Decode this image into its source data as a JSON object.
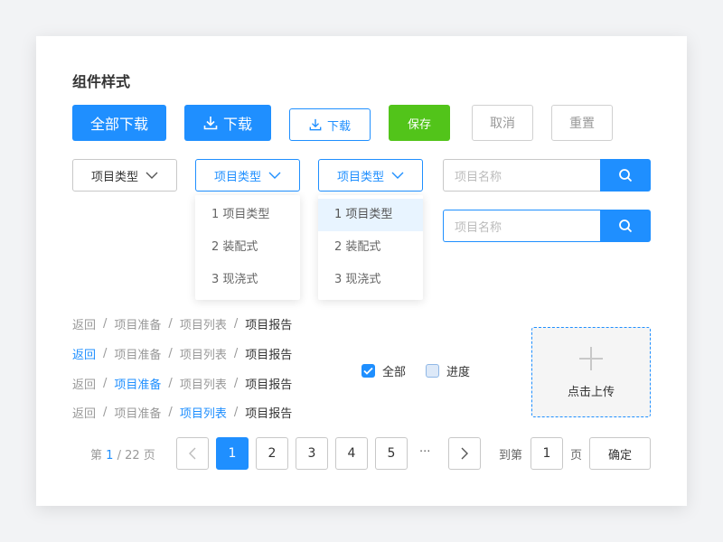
{
  "title": "组件样式",
  "buttons": {
    "download_all": "全部下载",
    "download": "下载",
    "download_small": "下载",
    "save": "保存",
    "cancel": "取消",
    "reset": "重置"
  },
  "selects": {
    "default_label": "项目类型",
    "open1_label": "项目类型",
    "open2_label": "项目类型",
    "options": [
      "1 项目类型",
      "2 装配式",
      "3 现浇式"
    ]
  },
  "search": {
    "placeholder": "项目名称"
  },
  "breadcrumbs": [
    {
      "items": [
        "返回",
        "项目准备",
        "项目列表",
        "项目报告"
      ],
      "active": -1
    },
    {
      "items": [
        "返回",
        "项目准备",
        "项目列表",
        "项目报告"
      ],
      "active": 0
    },
    {
      "items": [
        "返回",
        "项目准备",
        "项目列表",
        "项目报告"
      ],
      "active": 1
    },
    {
      "items": [
        "返回",
        "项目准备",
        "项目列表",
        "项目报告"
      ],
      "active": 2
    }
  ],
  "breadcrumb_separator": "/",
  "checkboxes": [
    {
      "label": "全部",
      "checked": true
    },
    {
      "label": "进度",
      "checked": false
    }
  ],
  "upload": {
    "label": "点击上传"
  },
  "pagination": {
    "prefix": "第",
    "current": "1",
    "slash": "/ 22",
    "suffix": "页",
    "pages": [
      "1",
      "2",
      "3",
      "4",
      "5"
    ],
    "ellipsis": "···",
    "goto_label": "到第",
    "goto_value": "1",
    "goto_suffix": "页",
    "confirm": "确定"
  },
  "colors": {
    "primary": "#1f8fff",
    "success": "#52c41a",
    "muted": "#999999"
  }
}
